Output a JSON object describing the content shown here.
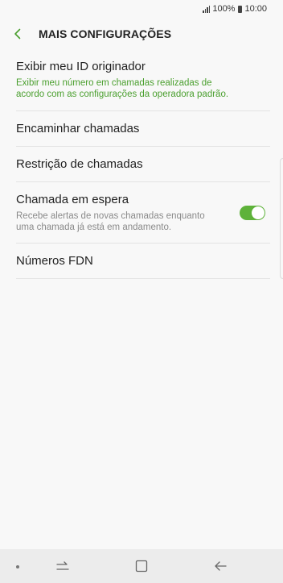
{
  "status_bar": {
    "battery": "100%",
    "time": "10:00"
  },
  "header": {
    "title": "MAIS CONFIGURAÇÕES",
    "back_icon": "chevron-left-icon"
  },
  "settings": [
    {
      "title": "Exibir meu ID originador",
      "subtitle_line1": "Exibir meu número em chamadas realizadas de",
      "subtitle_line2": "acordo com as configurações da operadora padrão."
    },
    {
      "title": "Encaminhar chamadas"
    },
    {
      "title": "Restrição de chamadas"
    },
    {
      "title": "Chamada em espera",
      "subtitle_line1": "Recebe alertas de novas chamadas enquanto",
      "subtitle_line2": "uma chamada já está em andamento.",
      "toggle_on": true
    },
    {
      "title": "Números FDN"
    }
  ],
  "colors": {
    "accent": "#4a9f2e",
    "toggle": "#5eb23a",
    "background": "#f8f8f8"
  },
  "nav_icons": [
    "dot-icon",
    "recents-icon",
    "home-icon",
    "back-arrow-icon"
  ]
}
